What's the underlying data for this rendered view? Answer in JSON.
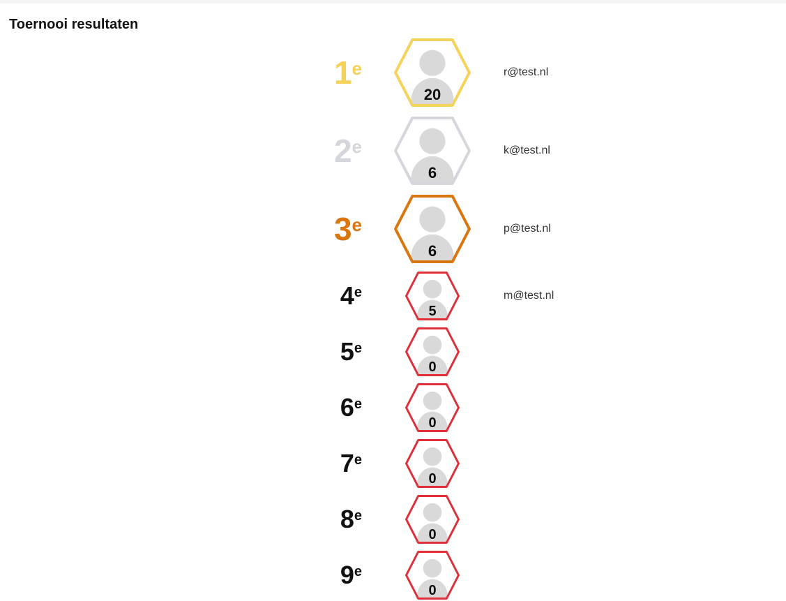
{
  "page": {
    "title": "Toernooi resultaten"
  },
  "colors": {
    "gold": "#f5d35a",
    "silver": "#d4d6dc",
    "bronze": "#d9760f",
    "red": "#e02e3a",
    "avatar": "#d9d9d9",
    "default_rank": "#111111"
  },
  "icons": {
    "avatar": "user-silhouette-icon"
  },
  "players": [
    {
      "rank": "1",
      "suffix": "e",
      "score": "20",
      "email": "r@test.nl",
      "tier": "gold"
    },
    {
      "rank": "2",
      "suffix": "e",
      "score": "6",
      "email": "k@test.nl",
      "tier": "silver"
    },
    {
      "rank": "3",
      "suffix": "e",
      "score": "6",
      "email": "p@test.nl",
      "tier": "bronze"
    },
    {
      "rank": "4",
      "suffix": "e",
      "score": "5",
      "email": "m@test.nl",
      "tier": "red"
    },
    {
      "rank": "5",
      "suffix": "e",
      "score": "0",
      "email": "",
      "tier": "red"
    },
    {
      "rank": "6",
      "suffix": "e",
      "score": "0",
      "email": "",
      "tier": "red"
    },
    {
      "rank": "7",
      "suffix": "e",
      "score": "0",
      "email": "",
      "tier": "red"
    },
    {
      "rank": "8",
      "suffix": "e",
      "score": "0",
      "email": "",
      "tier": "red"
    },
    {
      "rank": "9",
      "suffix": "e",
      "score": "0",
      "email": "",
      "tier": "red"
    }
  ]
}
